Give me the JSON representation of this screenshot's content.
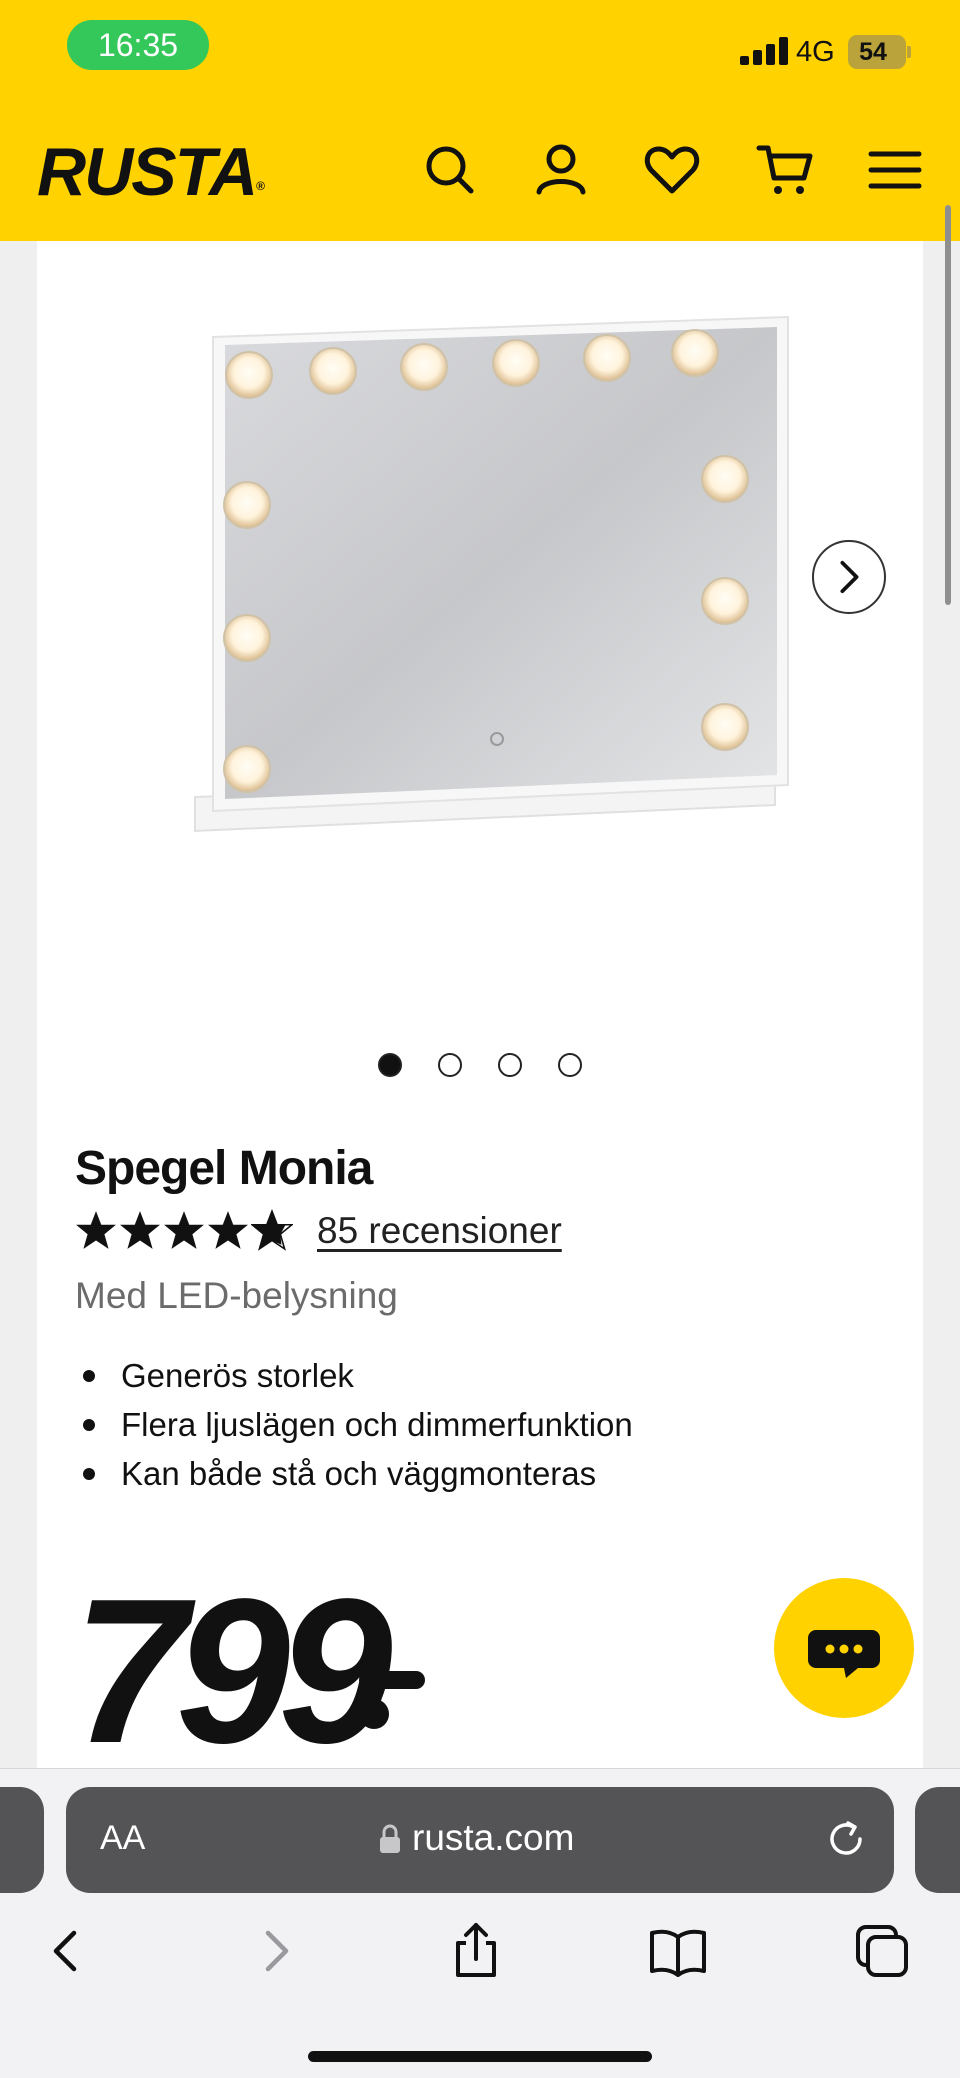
{
  "status_bar": {
    "time": "16:35",
    "network": "4G",
    "battery": "54"
  },
  "header": {
    "logo": "RUSTA",
    "logo_mark": "®",
    "icons": [
      "search-icon",
      "account-icon",
      "heart-icon",
      "cart-icon",
      "menu-icon"
    ]
  },
  "product": {
    "image_alt": "Spegel Monia",
    "carousel": {
      "total": 4,
      "active": 1
    },
    "title": "Spegel Monia",
    "rating": 4.5,
    "rating_max": 5,
    "reviews_text": "85 recensioner",
    "subtitle": "Med LED-belysning",
    "features": [
      "Generös storlek",
      "Flera ljuslägen och dimmerfunktion",
      "Kan både stå och väggmonteras"
    ],
    "price": "799"
  },
  "browser": {
    "text_size_label": "AA",
    "url": "rusta.com"
  },
  "colors": {
    "brand_yellow": "#ffd200",
    "text": "#111111",
    "muted": "#6b6b6b"
  }
}
